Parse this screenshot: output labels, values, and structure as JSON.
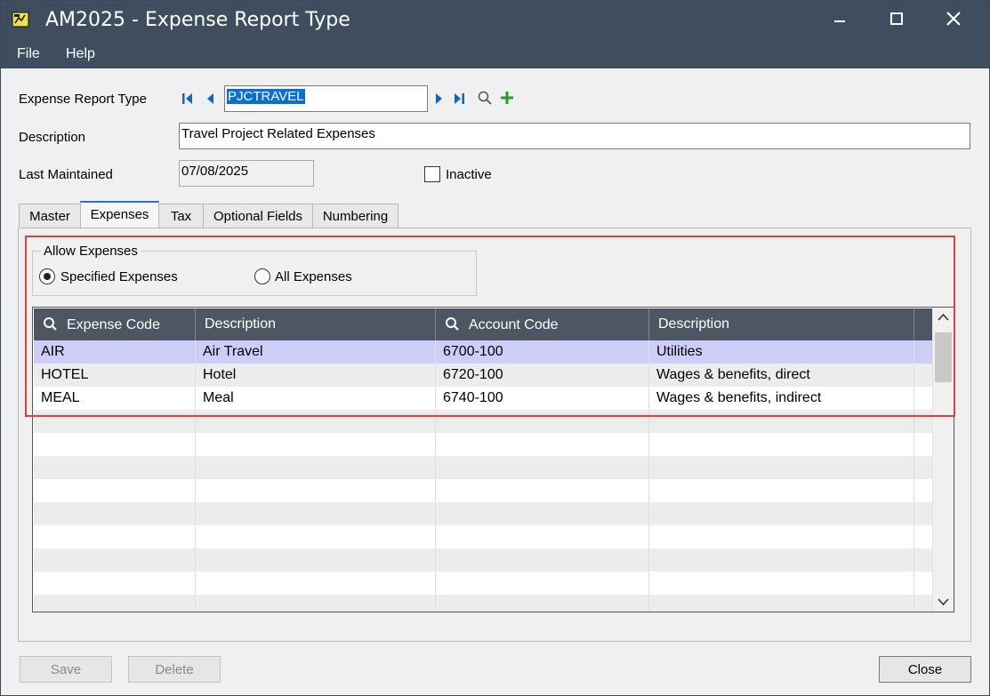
{
  "window": {
    "title": "AM2025 - Expense Report Type",
    "controls": {
      "minimize": "minimize",
      "maximize": "maximize",
      "close": "close"
    }
  },
  "menu": [
    "File",
    "Help"
  ],
  "form": {
    "expense_report_type_label": "Expense Report Type",
    "expense_report_type_value": "PJCTRAVEL",
    "description_label": "Description",
    "description_value": "Travel Project Related Expenses",
    "last_maintained_label": "Last Maintained",
    "last_maintained_value": "07/08/2025",
    "inactive_label": "Inactive",
    "inactive_checked": false
  },
  "tabs": [
    "Master",
    "Expenses",
    "Tax",
    "Optional Fields",
    "Numbering"
  ],
  "active_tab": "Expenses",
  "allow_expenses": {
    "title": "Allow Expenses",
    "options": [
      "Specified Expenses",
      "All Expenses"
    ],
    "selected": "Specified Expenses"
  },
  "grid": {
    "columns": [
      "Expense Code",
      "Description",
      "Account Code",
      "Description"
    ],
    "rows": [
      [
        "AIR",
        "Air Travel",
        "6700-100",
        "Utilities"
      ],
      [
        "HOTEL",
        "Hotel",
        "6720-100",
        "Wages & benefits, direct"
      ],
      [
        "MEAL",
        "Meal",
        "6740-100",
        "Wages & benefits, indirect"
      ]
    ],
    "selected_row": 0
  },
  "buttons": {
    "save": "Save",
    "delete": "Delete",
    "close": "Close"
  },
  "colors": {
    "titlebar": "#3e4e5e",
    "grid_header": "#4c5763",
    "selected_row": "#cdcdf8",
    "accent_green": "#2a9a2a",
    "nav_blue": "#1565c0",
    "highlight_box": "#e0413f"
  }
}
